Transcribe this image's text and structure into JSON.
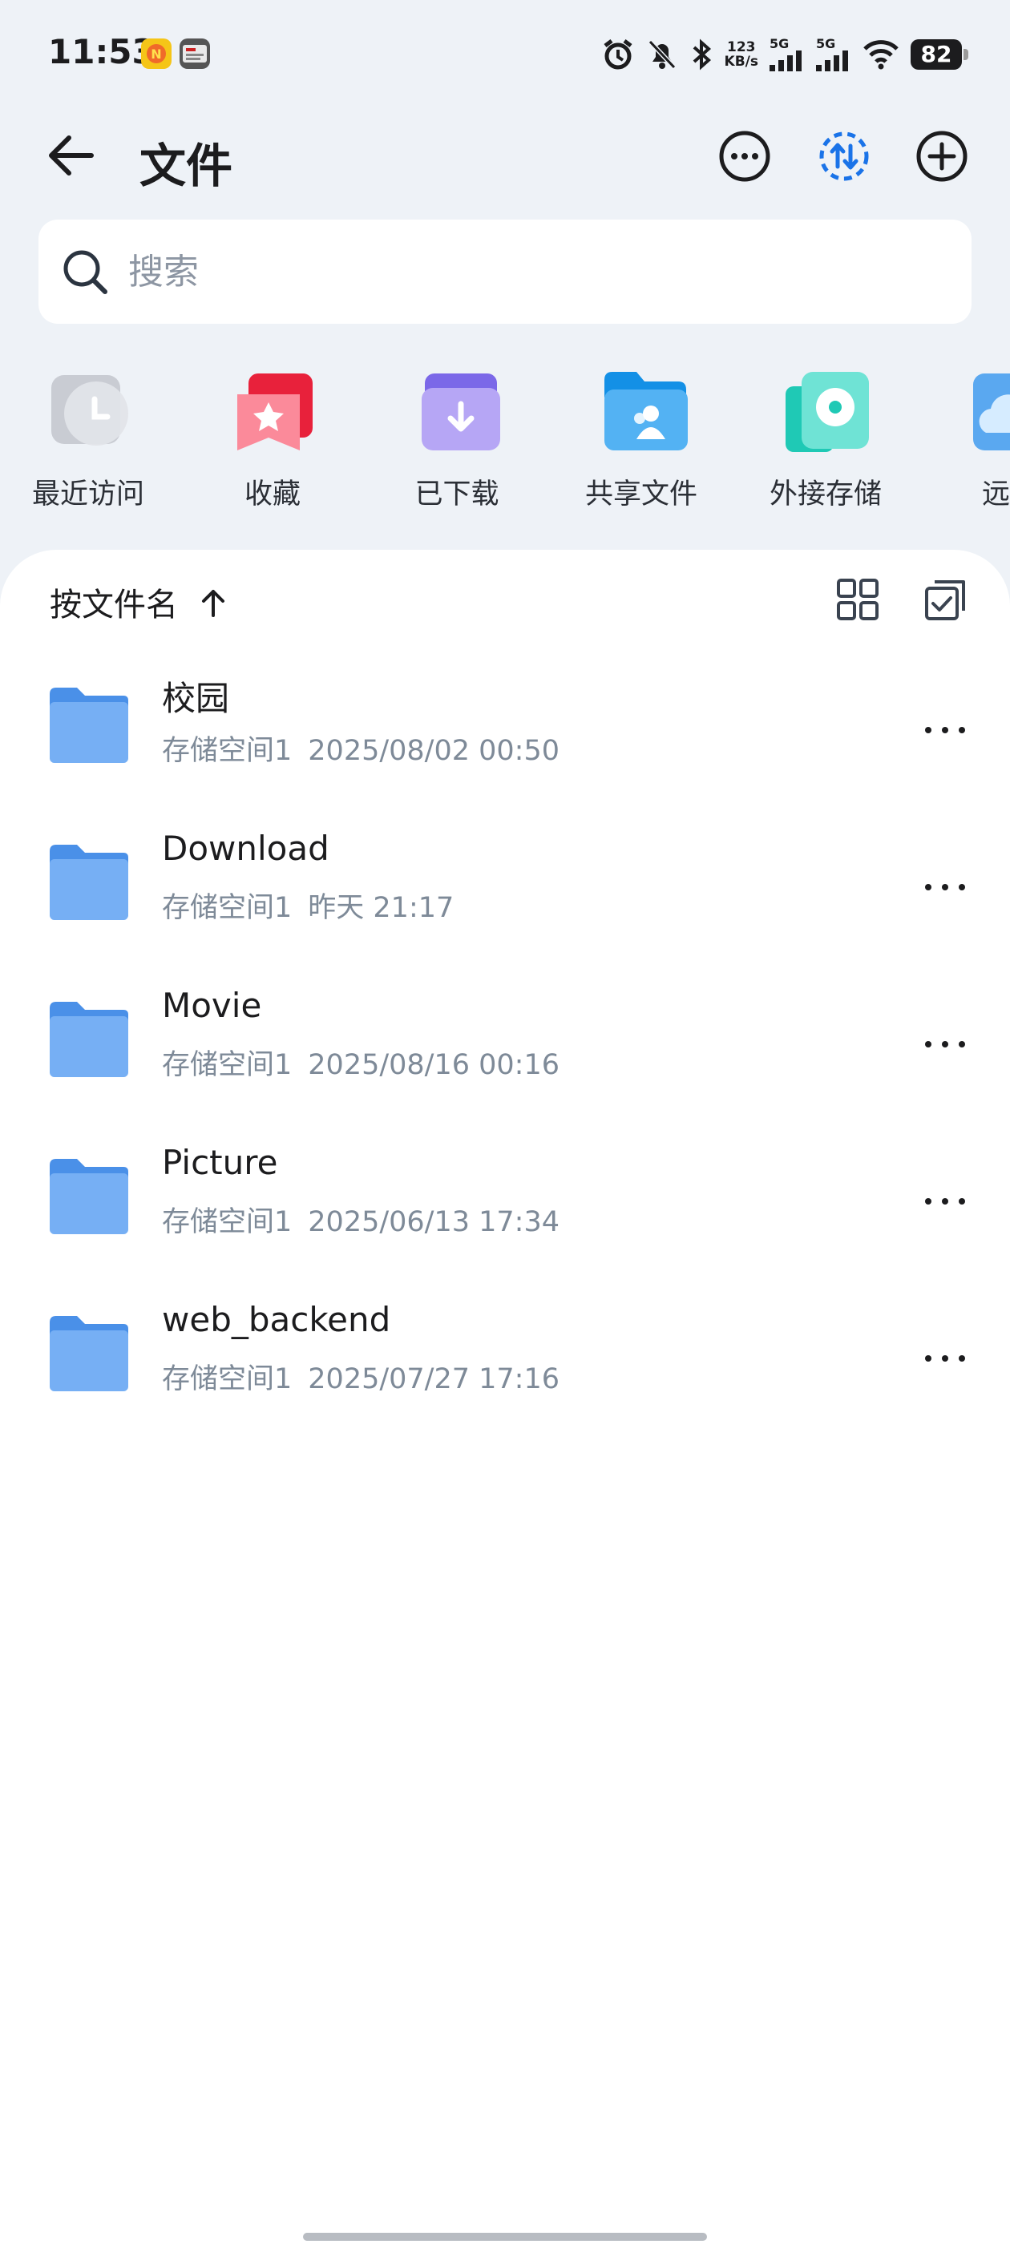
{
  "status_bar": {
    "time": "11:53",
    "net_speed_value": "123",
    "net_speed_unit": "KB/s",
    "signal1_label": "5G",
    "signal2_label": "5G",
    "battery": "82"
  },
  "header": {
    "title": "文件"
  },
  "search": {
    "placeholder": "搜索"
  },
  "quick_access": [
    {
      "label": "最近访问",
      "icon": "clock-icon"
    },
    {
      "label": "收藏",
      "icon": "star-bookmark-icon"
    },
    {
      "label": "已下载",
      "icon": "download-folder-icon"
    },
    {
      "label": "共享文件",
      "icon": "shared-folder-icon"
    },
    {
      "label": "外接存储",
      "icon": "external-storage-icon"
    },
    {
      "label": "远程",
      "icon": "cloud-icon"
    }
  ],
  "sort": {
    "label": "按文件名"
  },
  "files": [
    {
      "name": "校园",
      "location": "存储空间1",
      "date": "2025/08/02 00:50"
    },
    {
      "name": "Download",
      "location": "存储空间1",
      "date": "昨天 21:17"
    },
    {
      "name": "Movie",
      "location": "存储空间1",
      "date": "2025/08/16 00:16"
    },
    {
      "name": "Picture",
      "location": "存储空间1",
      "date": "2025/06/13 17:34"
    },
    {
      "name": "web_backend",
      "location": "存储空间1",
      "date": "2025/07/27 17:16"
    }
  ],
  "colors": {
    "background": "#eef2f7",
    "folder": "#4a90e8",
    "accent": "#1a73e8"
  }
}
